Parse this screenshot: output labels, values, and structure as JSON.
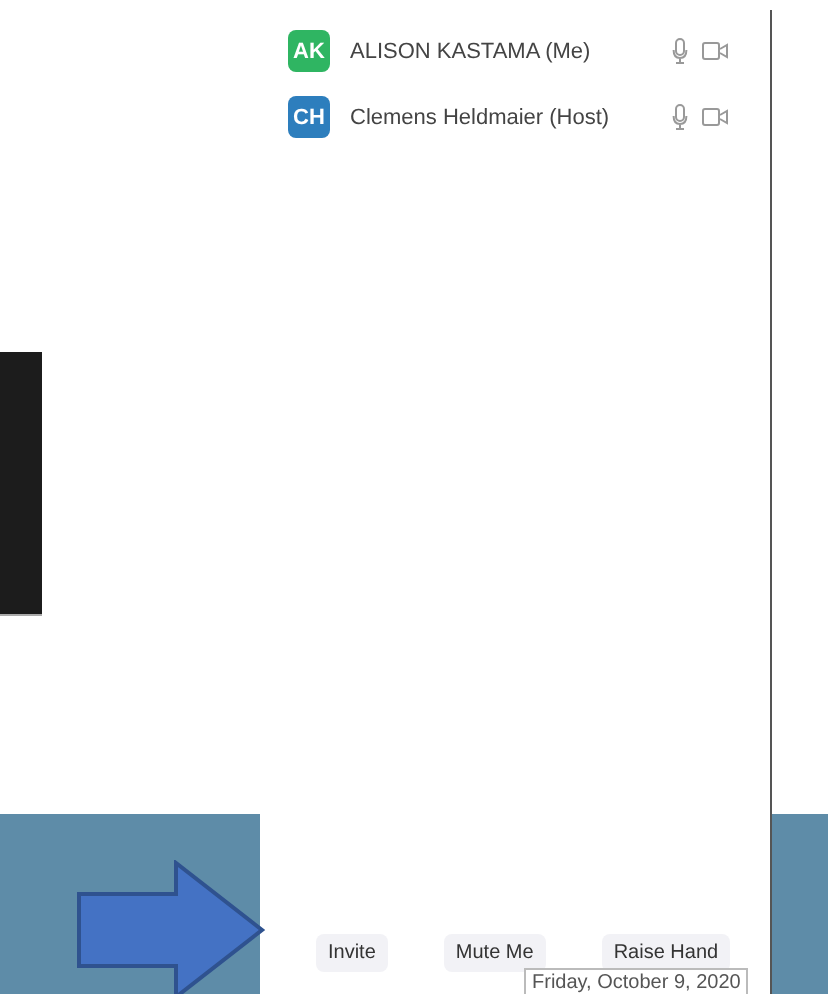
{
  "participants": [
    {
      "initials": "AK",
      "color": "#2fb562",
      "name": "ALISON KASTAMA (Me)"
    },
    {
      "initials": "CH",
      "color": "#2d7ebd",
      "name": "Clemens Heldmaier (Host)"
    }
  ],
  "buttons": [
    "Invite",
    "Mute Me",
    "Raise Hand"
  ],
  "tooltip": "Friday, October 9, 2020"
}
